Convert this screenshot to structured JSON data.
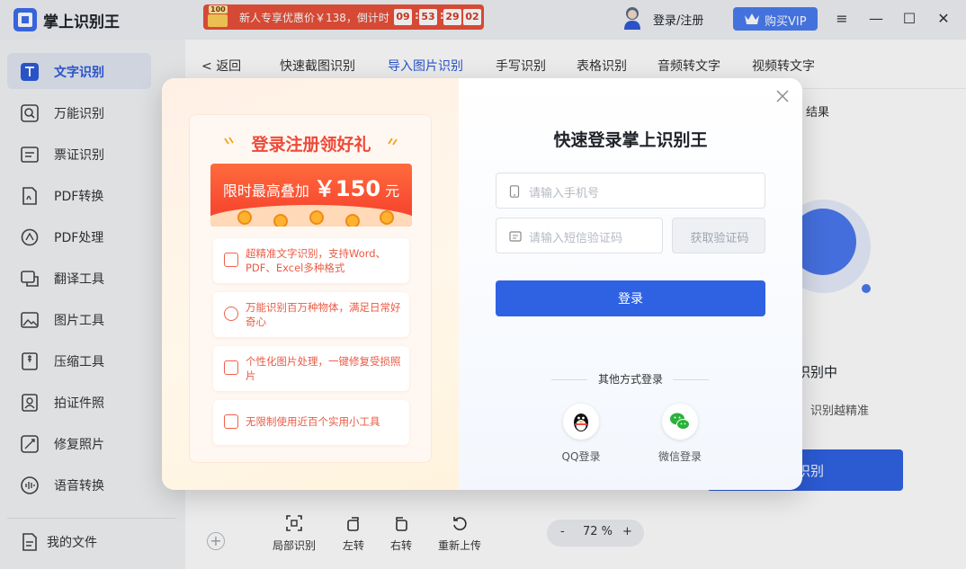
{
  "app": {
    "title": "掌上识别王"
  },
  "promo_bar": {
    "gift_tag": "100",
    "text": "新人专享优惠价￥138，倒计时",
    "countdown": [
      "09",
      "53",
      "29",
      "02"
    ]
  },
  "header": {
    "login_register": "登录/注册",
    "vip_label": "购买VIP"
  },
  "sidebar": {
    "items": [
      {
        "label": "文字识别",
        "icon": "text-recognition-icon"
      },
      {
        "label": "万能识别",
        "icon": "universal-scan-icon"
      },
      {
        "label": "票证识别",
        "icon": "ticket-icon"
      },
      {
        "label": "PDF转换",
        "icon": "pdf-convert-icon"
      },
      {
        "label": "PDF处理",
        "icon": "pdf-process-icon"
      },
      {
        "label": "翻译工具",
        "icon": "translate-icon"
      },
      {
        "label": "图片工具",
        "icon": "image-tool-icon"
      },
      {
        "label": "压缩工具",
        "icon": "compress-icon"
      },
      {
        "label": "拍证件照",
        "icon": "id-photo-icon"
      },
      {
        "label": "修复照片",
        "icon": "repair-photo-icon"
      },
      {
        "label": "语音转换",
        "icon": "voice-convert-icon"
      }
    ],
    "my_files": "我的文件"
  },
  "main": {
    "back": "返回",
    "tabs": [
      "快速截图识别",
      "导入图片识别",
      "手写识别",
      "表格识别",
      "音频转文字",
      "视频转文字"
    ],
    "active_tab": "导入图片识别",
    "hint_fragment": "结果",
    "status_fragment": "识别中",
    "sub_fragment": "识别越精准",
    "recognize_fragment": "识别",
    "tools": [
      "局部识别",
      "左转",
      "右转",
      "重新上传"
    ],
    "zoom": {
      "minus": "-",
      "value": "72 %",
      "plus": "+"
    }
  },
  "modal": {
    "promo_title": "登录注册领好礼",
    "banner_prefix": "限时最高叠加",
    "banner_amount": "￥150",
    "banner_unit": "元",
    "features": [
      "超精准文字识别，支持Word、PDF、Excel多种格式",
      "万能识别百万种物体，满足日常好奇心",
      "个性化图片处理，一键修复受损照片",
      "无限制使用近百个实用小工具"
    ],
    "login_title": "快速登录掌上识别王",
    "phone_placeholder": "请输入手机号",
    "code_placeholder": "请输入短信验证码",
    "get_code": "获取验证码",
    "login_button": "登录",
    "other_methods": "其他方式登录",
    "qq_label": "QQ登录",
    "wechat_label": "微信登录"
  },
  "colors": {
    "accent": "#2f62e3",
    "promo_red": "#ef4a3a",
    "vip": "#4a7cf0"
  }
}
